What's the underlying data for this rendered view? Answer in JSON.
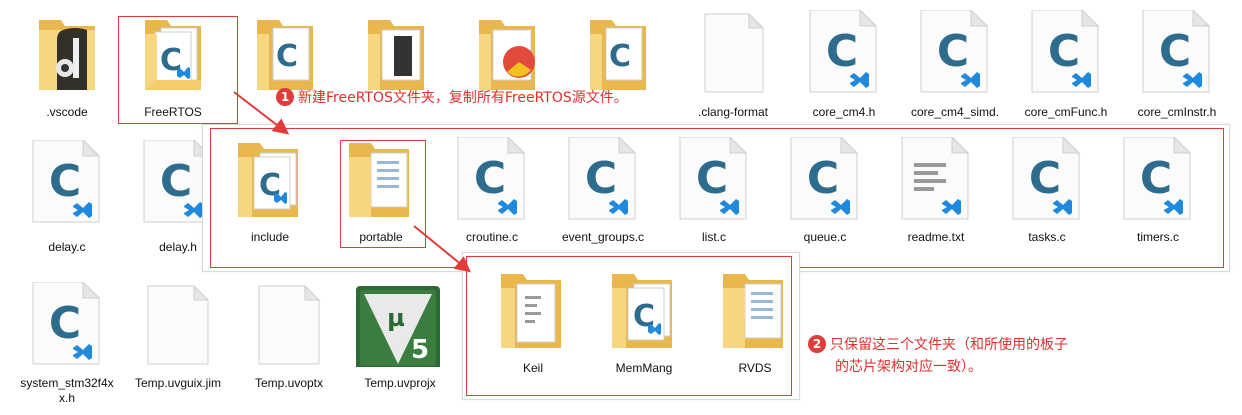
{
  "top_row": [
    {
      "name": ".vscode",
      "type": "folder-vscode"
    },
    {
      "name": "FreeRTOS",
      "type": "folder-c"
    },
    {
      "name": "",
      "type": "folder-c"
    },
    {
      "name": "",
      "type": "folder-doc"
    },
    {
      "name": "",
      "type": "folder-chrome"
    },
    {
      "name": "",
      "type": "folder-c"
    },
    {
      "name": ".clang-format",
      "type": "file-blank"
    },
    {
      "name": "core_cm4.h",
      "type": "file-c"
    },
    {
      "name": "core_cm4_simd.",
      "type": "file-c"
    },
    {
      "name": "core_cmFunc.h",
      "type": "file-c"
    },
    {
      "name": "core_cmInstr.h",
      "type": "file-c"
    }
  ],
  "left_column": [
    {
      "name": "delay.c",
      "type": "file-c"
    },
    {
      "name": "delay.h",
      "type": "file-c"
    }
  ],
  "bottom_row": [
    {
      "name": "system_stm32f4xx.h",
      "type": "file-c"
    },
    {
      "name": "Temp.uvguix.jim",
      "type": "file-blank"
    },
    {
      "name": "Temp.uvoptx",
      "type": "file-blank"
    },
    {
      "name": "Temp.uvprojx",
      "type": "keil-mu5"
    }
  ],
  "freertos_panel": [
    {
      "name": "include",
      "type": "folder-c"
    },
    {
      "name": "portable",
      "type": "folder-doc"
    },
    {
      "name": "croutine.c",
      "type": "file-c"
    },
    {
      "name": "event_groups.c",
      "type": "file-c"
    },
    {
      "name": "list.c",
      "type": "file-c"
    },
    {
      "name": "queue.c",
      "type": "file-c"
    },
    {
      "name": "readme.txt",
      "type": "file-txt"
    },
    {
      "name": "tasks.c",
      "type": "file-c"
    },
    {
      "name": "timers.c",
      "type": "file-c"
    }
  ],
  "portable_panel": [
    {
      "name": "Keil",
      "type": "folder-txt"
    },
    {
      "name": "MemMang",
      "type": "folder-c"
    },
    {
      "name": "RVDS",
      "type": "folder-doc"
    }
  ],
  "annotations": {
    "one_badge": "1",
    "one_text": "新建FreeRTOS文件夹，复制所有FreeRTOS源文件。",
    "two_badge": "2",
    "two_line1": "只保留这三个文件夹（和所使用的板子",
    "two_line2": "的芯片架构对应一致）。"
  },
  "colors": {
    "accent_red": "#e23b3b",
    "folder": "#f6d27e",
    "c_blue": "#2f6e8f",
    "vs_blue": "#1e88e5"
  }
}
